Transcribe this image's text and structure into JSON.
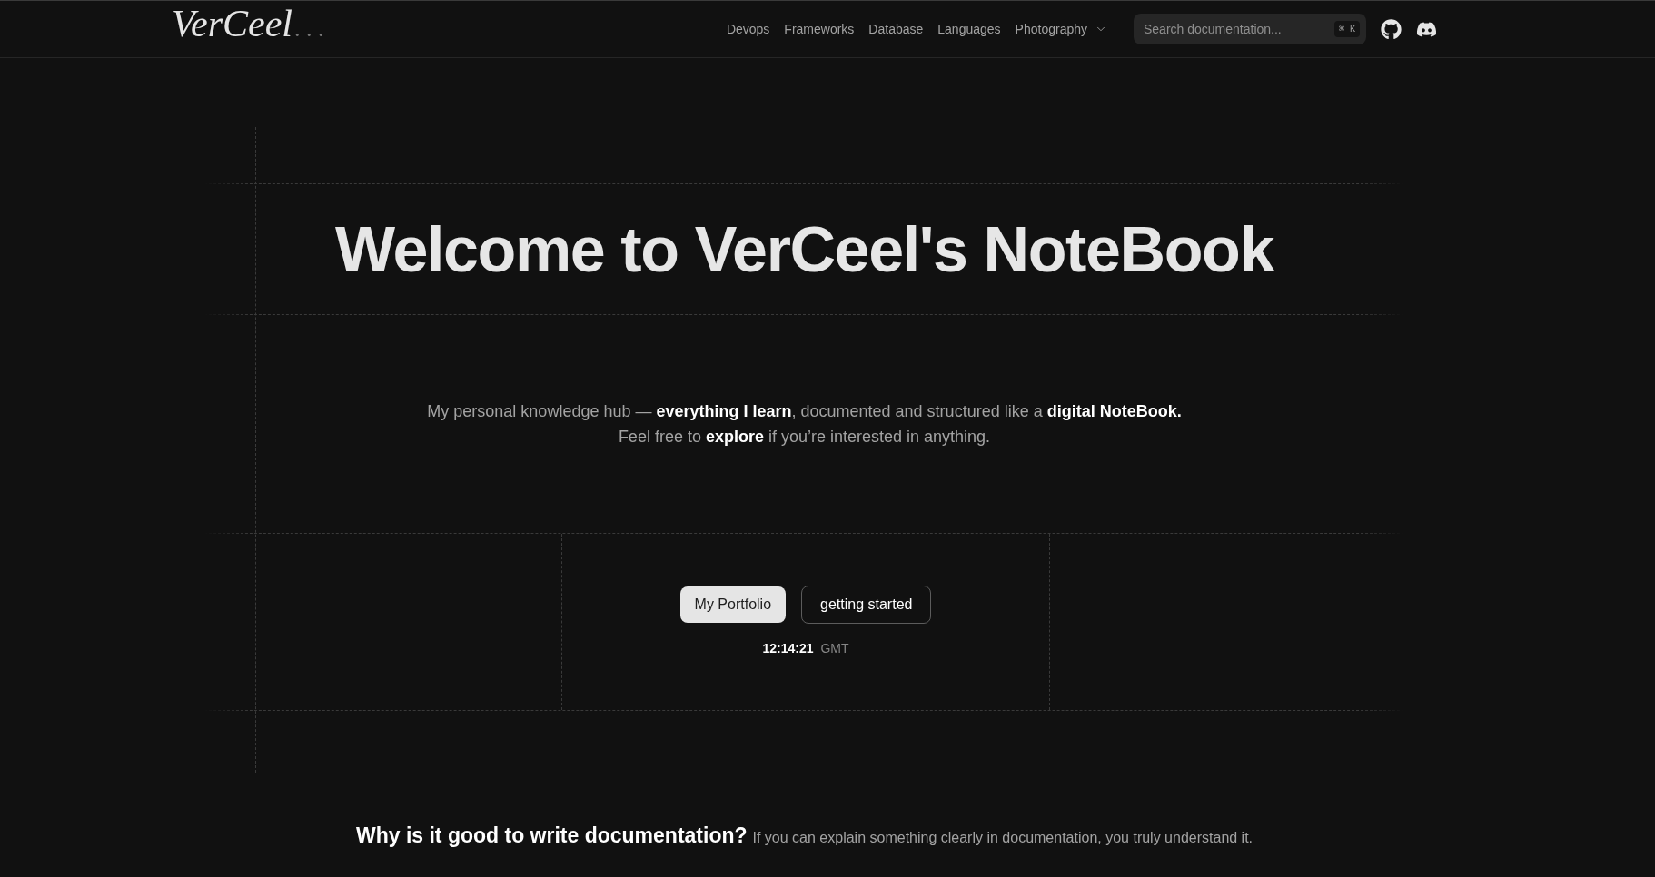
{
  "header": {
    "logo": {
      "name": "VerCeel",
      "suffix": "..."
    },
    "nav": [
      {
        "label": "Devops",
        "kind": "link"
      },
      {
        "label": "Frameworks",
        "kind": "link"
      },
      {
        "label": "Database",
        "kind": "link"
      },
      {
        "label": "Languages",
        "kind": "link"
      },
      {
        "label": "Photography",
        "kind": "dropdown"
      }
    ],
    "search": {
      "placeholder": "Search documentation...",
      "shortcut": "⌘ K"
    },
    "social_links": [
      {
        "kind": "github"
      },
      {
        "kind": "discord"
      }
    ]
  },
  "hero": {
    "title": "Welcome to VerCeel's NoteBook",
    "intro": [
      "My personal knowledge hub — **everything I learn**, documented and structured like a **digital NoteBook.**",
      "Feel free to **explore** if you’re interested in anything."
    ],
    "buttons": [
      {
        "label": "My Portfolio",
        "kind": "primary"
      },
      {
        "label": "getting started",
        "kind": "outline"
      }
    ],
    "clock": {
      "time": "12:14:21",
      "zone": "GMT"
    }
  },
  "why_section": {
    "heading": "Why is it good to write documentation?",
    "text": "If you can explain something clearly in documentation, you truly understand it."
  }
}
